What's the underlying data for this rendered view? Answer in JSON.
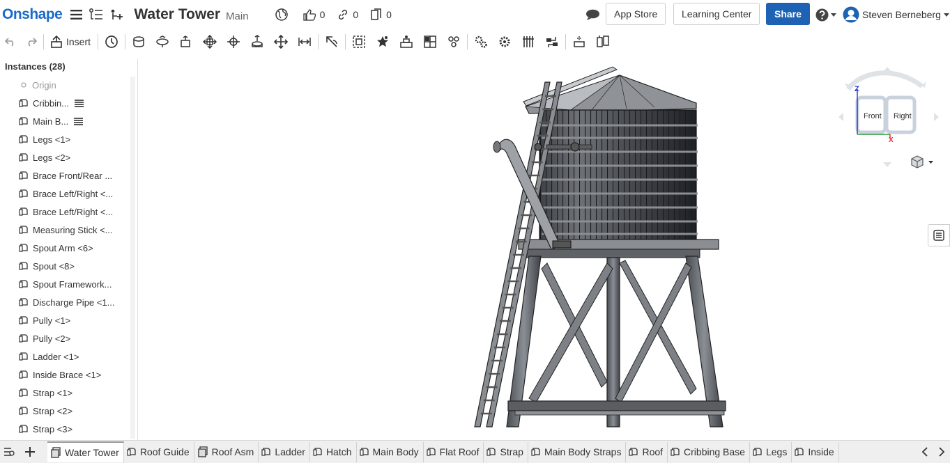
{
  "header": {
    "logo": "Onshape",
    "doc_title": "Water Tower",
    "branch": "Main",
    "likes": "0",
    "links": "0",
    "copies": "0",
    "app_store": "App Store",
    "learning_center": "Learning Center",
    "share": "Share",
    "user": "Steven Berneberg"
  },
  "toolbar": {
    "insert_label": "Insert"
  },
  "panel": {
    "heading": "Instances (28)",
    "origin": "Origin",
    "instances": [
      {
        "label": "Cribbin...",
        "flex": true
      },
      {
        "label": "Main B...",
        "flex": true
      },
      {
        "label": "Legs <1>",
        "flex": false
      },
      {
        "label": "Legs <2>",
        "flex": false
      },
      {
        "label": "Brace Front/Rear ...",
        "flex": false
      },
      {
        "label": "Brace Left/Right <...",
        "flex": false
      },
      {
        "label": "Brace Left/Right <...",
        "flex": false
      },
      {
        "label": "Measuring Stick <...",
        "flex": false
      },
      {
        "label": "Spout Arm <6>",
        "flex": false
      },
      {
        "label": "Spout <8>",
        "flex": false
      },
      {
        "label": "Spout Framework...",
        "flex": false
      },
      {
        "label": "Discharge Pipe <1...",
        "flex": false
      },
      {
        "label": "Pully <1>",
        "flex": false
      },
      {
        "label": "Pully <2>",
        "flex": false
      },
      {
        "label": "Ladder <1>",
        "flex": false
      },
      {
        "label": "Inside Brace <1>",
        "flex": false
      },
      {
        "label": "Strap <1>",
        "flex": false
      },
      {
        "label": "Strap <2>",
        "flex": false
      },
      {
        "label": "Strap <3>",
        "flex": false
      }
    ]
  },
  "viewcube": {
    "front": "Front",
    "right": "Right",
    "axis_z": "Z",
    "axis_x": "X"
  },
  "tabs": [
    {
      "label": "Water Tower",
      "kind": "assembly",
      "active": true
    },
    {
      "label": "Roof Guide",
      "kind": "part",
      "active": false
    },
    {
      "label": "Roof Asm",
      "kind": "assembly",
      "active": false
    },
    {
      "label": "Ladder",
      "kind": "part",
      "active": false
    },
    {
      "label": "Hatch",
      "kind": "part",
      "active": false
    },
    {
      "label": "Main Body",
      "kind": "part",
      "active": false
    },
    {
      "label": "Flat Roof",
      "kind": "part",
      "active": false
    },
    {
      "label": "Strap",
      "kind": "part",
      "active": false
    },
    {
      "label": "Main Body Straps",
      "kind": "part",
      "active": false
    },
    {
      "label": "Roof",
      "kind": "part",
      "active": false
    },
    {
      "label": "Cribbing Base",
      "kind": "part",
      "active": false
    },
    {
      "label": "Legs",
      "kind": "part",
      "active": false
    },
    {
      "label": "Inside",
      "kind": "part",
      "active": false
    }
  ],
  "colors": {
    "brand": "#1b6ac9",
    "share_button": "#1e62b4",
    "model_gray": "#6f7378"
  }
}
